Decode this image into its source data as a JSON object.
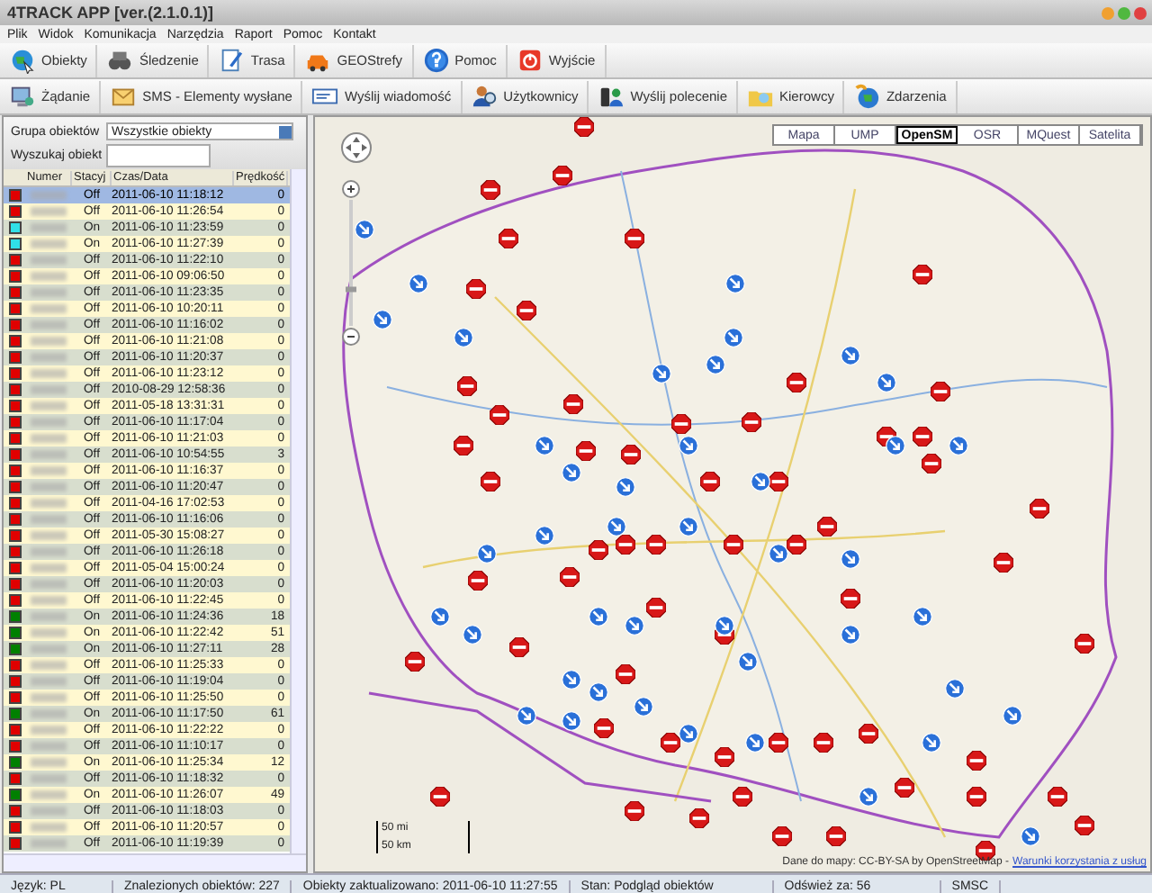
{
  "window": {
    "title": "4TRACK APP [ver.(2.1.0.1)]"
  },
  "menu": [
    "Plik",
    "Widok",
    "Komunikacja",
    "Narzędzia",
    "Raport",
    "Pomoc",
    "Kontakt"
  ],
  "toolbar_1": [
    "Obiekty",
    "Śledzenie",
    "Trasa",
    "GEOStrefy",
    "Pomoc",
    "Wyjście"
  ],
  "toolbar_2": [
    "Żądanie",
    "SMS - Elementy wysłane",
    "Wyślij wiadomość",
    "Użytkownicy",
    "Wyślij polecenie",
    "Kierowcy",
    "Zdarzenia"
  ],
  "filter": {
    "group_label": "Grupa obiektów",
    "group_value": "Wszystkie obiekty",
    "search_label": "Wyszukaj obiekt"
  },
  "table": {
    "columns": [
      "Numer",
      "Stacyj",
      "Czas/Data",
      "Prędkość"
    ],
    "rows": [
      {
        "color": "#e00000",
        "station": "Off",
        "time": "2011-06-10 11:18:12",
        "speed": "0",
        "selected": true
      },
      {
        "color": "#e00000",
        "station": "Off",
        "time": "2011-06-10 11:26:54",
        "speed": "0",
        "selected": false
      },
      {
        "color": "#30e0e8",
        "station": "On",
        "time": "2011-06-10 11:23:59",
        "speed": "0",
        "selected": false
      },
      {
        "color": "#30e0e8",
        "station": "On",
        "time": "2011-06-10 11:27:39",
        "speed": "0",
        "selected": false
      },
      {
        "color": "#e00000",
        "station": "Off",
        "time": "2011-06-10 11:22:10",
        "speed": "0",
        "selected": false
      },
      {
        "color": "#e00000",
        "station": "Off",
        "time": "2011-06-10 09:06:50",
        "speed": "0",
        "selected": false
      },
      {
        "color": "#e00000",
        "station": "Off",
        "time": "2011-06-10 11:23:35",
        "speed": "0",
        "selected": false
      },
      {
        "color": "#e00000",
        "station": "Off",
        "time": "2011-06-10 10:20:11",
        "speed": "0",
        "selected": false
      },
      {
        "color": "#e00000",
        "station": "Off",
        "time": "2011-06-10 11:16:02",
        "speed": "0",
        "selected": false
      },
      {
        "color": "#e00000",
        "station": "Off",
        "time": "2011-06-10 11:21:08",
        "speed": "0",
        "selected": false
      },
      {
        "color": "#e00000",
        "station": "Off",
        "time": "2011-06-10 11:20:37",
        "speed": "0",
        "selected": false
      },
      {
        "color": "#e00000",
        "station": "Off",
        "time": "2011-06-10 11:23:12",
        "speed": "0",
        "selected": false
      },
      {
        "color": "#e00000",
        "station": "Off",
        "time": "2010-08-29 12:58:36",
        "speed": "0",
        "selected": false
      },
      {
        "color": "#e00000",
        "station": "Off",
        "time": "2011-05-18 13:31:31",
        "speed": "0",
        "selected": false
      },
      {
        "color": "#e00000",
        "station": "Off",
        "time": "2011-06-10 11:17:04",
        "speed": "0",
        "selected": false
      },
      {
        "color": "#e00000",
        "station": "Off",
        "time": "2011-06-10 11:21:03",
        "speed": "0",
        "selected": false
      },
      {
        "color": "#e00000",
        "station": "Off",
        "time": "2011-06-10 10:54:55",
        "speed": "3",
        "selected": false
      },
      {
        "color": "#e00000",
        "station": "Off",
        "time": "2011-06-10 11:16:37",
        "speed": "0",
        "selected": false
      },
      {
        "color": "#e00000",
        "station": "Off",
        "time": "2011-06-10 11:20:47",
        "speed": "0",
        "selected": false
      },
      {
        "color": "#e00000",
        "station": "Off",
        "time": "2011-04-16 17:02:53",
        "speed": "0",
        "selected": false
      },
      {
        "color": "#e00000",
        "station": "Off",
        "time": "2011-06-10 11:16:06",
        "speed": "0",
        "selected": false
      },
      {
        "color": "#e00000",
        "station": "Off",
        "time": "2011-05-30 15:08:27",
        "speed": "0",
        "selected": false
      },
      {
        "color": "#e00000",
        "station": "Off",
        "time": "2011-06-10 11:26:18",
        "speed": "0",
        "selected": false
      },
      {
        "color": "#e00000",
        "station": "Off",
        "time": "2011-05-04 15:00:24",
        "speed": "0",
        "selected": false
      },
      {
        "color": "#e00000",
        "station": "Off",
        "time": "2011-06-10 11:20:03",
        "speed": "0",
        "selected": false
      },
      {
        "color": "#e00000",
        "station": "Off",
        "time": "2011-06-10 11:22:45",
        "speed": "0",
        "selected": false
      },
      {
        "color": "#008000",
        "station": "On",
        "time": "2011-06-10 11:24:36",
        "speed": "18",
        "selected": false
      },
      {
        "color": "#008000",
        "station": "On",
        "time": "2011-06-10 11:22:42",
        "speed": "51",
        "selected": false
      },
      {
        "color": "#008000",
        "station": "On",
        "time": "2011-06-10 11:27:11",
        "speed": "28",
        "selected": false
      },
      {
        "color": "#e00000",
        "station": "Off",
        "time": "2011-06-10 11:25:33",
        "speed": "0",
        "selected": false
      },
      {
        "color": "#e00000",
        "station": "Off",
        "time": "2011-06-10 11:19:04",
        "speed": "0",
        "selected": false
      },
      {
        "color": "#e00000",
        "station": "Off",
        "time": "2011-06-10 11:25:50",
        "speed": "0",
        "selected": false
      },
      {
        "color": "#008000",
        "station": "On",
        "time": "2011-06-10 11:17:50",
        "speed": "61",
        "selected": false
      },
      {
        "color": "#e00000",
        "station": "Off",
        "time": "2011-06-10 11:22:22",
        "speed": "0",
        "selected": false
      },
      {
        "color": "#e00000",
        "station": "Off",
        "time": "2011-06-10 11:10:17",
        "speed": "0",
        "selected": false
      },
      {
        "color": "#008000",
        "station": "On",
        "time": "2011-06-10 11:25:34",
        "speed": "12",
        "selected": false
      },
      {
        "color": "#e00000",
        "station": "Off",
        "time": "2011-06-10 11:18:32",
        "speed": "0",
        "selected": false
      },
      {
        "color": "#008000",
        "station": "On",
        "time": "2011-06-10 11:26:07",
        "speed": "49",
        "selected": false
      },
      {
        "color": "#e00000",
        "station": "Off",
        "time": "2011-06-10 11:18:03",
        "speed": "0",
        "selected": false
      },
      {
        "color": "#e00000",
        "station": "Off",
        "time": "2011-06-10 11:20:57",
        "speed": "0",
        "selected": false
      },
      {
        "color": "#e00000",
        "station": "Off",
        "time": "2011-06-10 11:19:39",
        "speed": "0",
        "selected": false
      }
    ]
  },
  "map": {
    "zoom": {
      "level": 0.28
    },
    "layers": [
      {
        "label": "Mapa",
        "selected": false
      },
      {
        "label": "UMP",
        "selected": false
      },
      {
        "label": "OpenSM",
        "selected": true
      },
      {
        "label": "OSR",
        "selected": false
      },
      {
        "label": "MQuest",
        "selected": false
      },
      {
        "label": "Satelita",
        "selected": false
      }
    ],
    "scale": {
      "miles": "50 mi",
      "km": "50 km"
    },
    "attribution": "Dane do mapy: CC-BY-SA by OpenStreetMap -",
    "terms_link": "Warunki korzystania z usług"
  },
  "status_bar": [
    "Język: PL",
    "Znalezionych obiektów: 227",
    "Obiekty zaktualizowano: 2011-06-10 11:27:55",
    "Stan: Podgląd obiektów",
    "Odśwież za: 56",
    "SMSC"
  ]
}
